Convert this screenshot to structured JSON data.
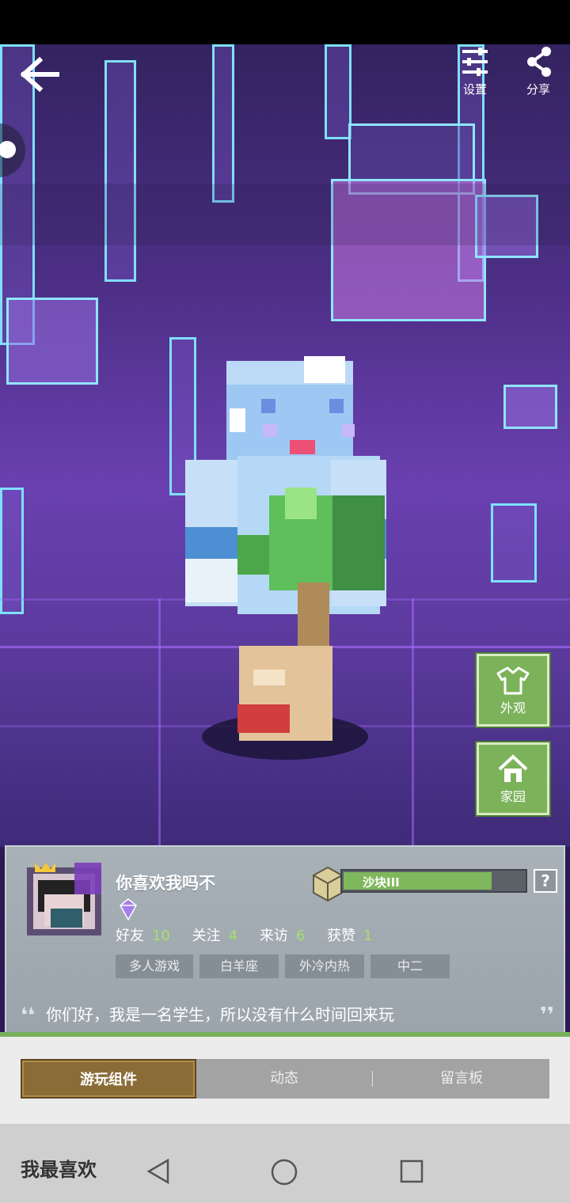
{
  "header": {
    "back": "back-arrow",
    "settings_label": "设置",
    "share_label": "分享"
  },
  "side_buttons": {
    "appearance_label": "外观",
    "home_label": "家园"
  },
  "profile": {
    "username": "你喜欢我吗不",
    "level_label": "沙块III",
    "level_progress": 0.82,
    "help": "?",
    "stats": [
      {
        "label": "好友",
        "value": "10"
      },
      {
        "label": "关注",
        "value": "4"
      },
      {
        "label": "来访",
        "value": "6"
      },
      {
        "label": "获赞",
        "value": "1"
      }
    ],
    "tags": [
      "多人游戏",
      "白羊座",
      "外冷内热",
      "中二"
    ],
    "bio": "你们好，我是一名学生，所以没有什么时间回来玩",
    "quote_left": "❛❛",
    "quote_right": "❜❜"
  },
  "tabs": [
    "游玩组件",
    "动态",
    "留言板"
  ],
  "section_title": "我最喜欢",
  "colors": {
    "accent_green": "#7cb35a",
    "tab_active": "#8a6c37"
  }
}
